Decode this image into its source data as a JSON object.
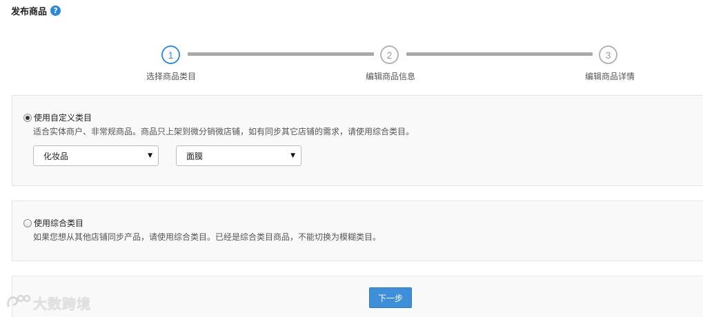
{
  "header": {
    "title": "发布商品",
    "help_icon": "question-icon"
  },
  "stepper": {
    "steps": [
      {
        "number": "1",
        "label": "选择商品类目",
        "state": "active"
      },
      {
        "number": "2",
        "label": "编辑商品信息",
        "state": "inactive"
      },
      {
        "number": "3",
        "label": "编辑商品详情",
        "state": "inactive"
      }
    ]
  },
  "custom_category": {
    "radio_label": "使用自定义类目",
    "selected": true,
    "description": "适合实体商户、非常规商品。商品只上架到微分销微店铺，如有同步其它店铺的需求，请使用综合类目。",
    "select_1": {
      "value": "化妆品"
    },
    "select_2": {
      "value": "面膜"
    }
  },
  "general_category": {
    "radio_label": "使用综合类目",
    "selected": false,
    "description": "如果您想从其他店铺同步产品，请使用综合类目。已经是综合类目商品，不能切换为模糊类目。"
  },
  "footer": {
    "next_label": "下一步"
  },
  "watermark": {
    "text": "大数跨境"
  },
  "colors": {
    "accent": "#3a8bd0",
    "button": "#3e8fd8",
    "panel_bg": "#f9f9f9",
    "step_inactive": "#a8a8a8"
  }
}
